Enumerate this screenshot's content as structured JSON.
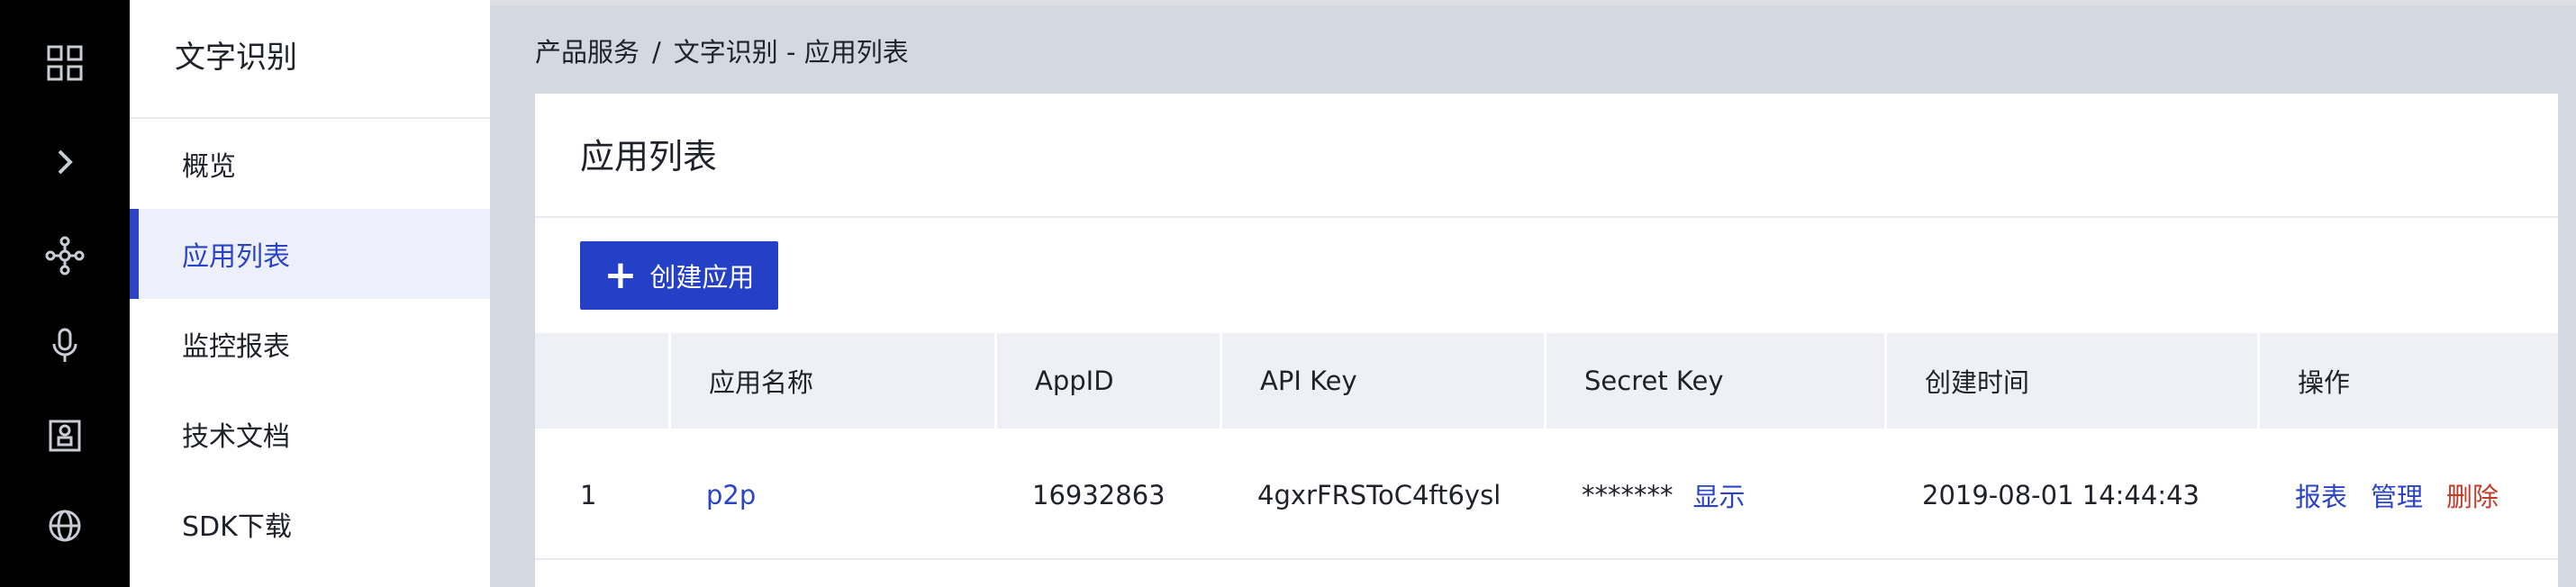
{
  "rail": {
    "icons": [
      "grid-icon",
      "chevron-right-icon",
      "network-icon",
      "microphone-icon",
      "robot-icon",
      "globe-icon"
    ]
  },
  "nav": {
    "title": "文字识别",
    "items": [
      {
        "label": "概览",
        "active": false
      },
      {
        "label": "应用列表",
        "active": true
      },
      {
        "label": "监控报表",
        "active": false
      },
      {
        "label": "技术文档",
        "active": false
      },
      {
        "label": "SDK下载",
        "active": false
      }
    ]
  },
  "breadcrumb": {
    "root": "产品服务",
    "separator": "/",
    "current": "文字识别 - 应用列表"
  },
  "main": {
    "title": "应用列表",
    "create_button": "创建应用",
    "table": {
      "headers": [
        "",
        "应用名称",
        "AppID",
        "API Key",
        "Secret Key",
        "创建时间",
        "操作"
      ],
      "rows": [
        {
          "index": "1",
          "name": "p2p",
          "app_id": "16932863",
          "api_key": "4gxrFRSToC4ft6ysl",
          "secret_key_masked": "*******",
          "show_label": "显示",
          "created": "2019-08-01 14:44:43",
          "actions": {
            "report": "报表",
            "manage": "管理",
            "delete": "删除"
          }
        }
      ]
    }
  },
  "colors": {
    "accent": "#2440c6",
    "link": "#2b44c7",
    "danger": "#c43a26",
    "rail_bg": "#000000",
    "page_bg": "#d4d8e0"
  }
}
